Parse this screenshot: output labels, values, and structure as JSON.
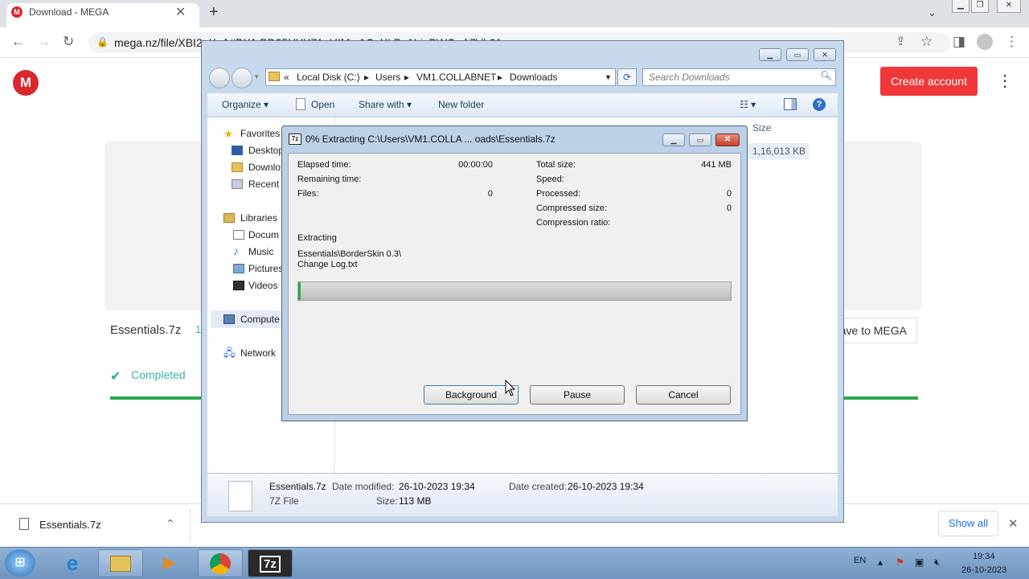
{
  "browser": {
    "tab_title": "Download - MEGA",
    "tab_favicon": "M",
    "tab_close": "✕",
    "new_tab": "+",
    "url": "mega.nz/file/XBI2~K~1#BX1:BD35YYX71_UIM...1C_XLB_1Li_BWQ_A7VL91",
    "window_controls": [
      "▁",
      "❐",
      "✕"
    ],
    "nav_icons": [
      "arrow-left-icon",
      "arrow-right-icon",
      "reload-icon",
      "lock-icon",
      "share-icon",
      "star-icon",
      "sidebar-icon",
      "profile-icon",
      "menu-icon"
    ]
  },
  "mega": {
    "logo": "M",
    "create_account": "Create account",
    "menu_glyph": "⋮",
    "filename": "Essentials.7z",
    "size_fragment": "1",
    "save_to_mega": "ave to MEGA",
    "completed": "Completed",
    "check": "✔",
    "colors": {
      "brand": "#d9272e",
      "button": "#f0373a",
      "progress": "#2ba84e"
    }
  },
  "downloads_shelf": {
    "filename": "Essentials.7z",
    "chevron": "⌃",
    "show_all": "Show all",
    "close": "✕"
  },
  "explorer": {
    "breadcrumbs": [
      "«",
      "Local Disk (C:)",
      "Users",
      "VM1.COLLABNET",
      "Downloads"
    ],
    "search_placeholder": "Search Downloads",
    "commands": {
      "organize": "Organize ▾",
      "open": "Open",
      "share_with": "Share with ▾",
      "new_folder": "New folder"
    },
    "nav": {
      "favorites": "Favorites",
      "desktop": "Desktop",
      "downloads": "Downlo",
      "recent": "Recent",
      "libraries": "Libraries",
      "documents": "Docum",
      "music": "Music",
      "pictures": "Pictures",
      "videos": "Videos",
      "computer": "Compute",
      "network": "Network"
    },
    "column_size": "Size",
    "file_size": "1,16,013 KB",
    "details": {
      "name": "Essentials.7z",
      "type": "7Z File",
      "date_modified_label": "Date modified:",
      "date_modified": "26-10-2023 19:34",
      "size_label": "Size:",
      "size": "113 MB",
      "date_created_label": "Date created:",
      "date_created": "26-10-2023 19:34"
    }
  },
  "sevenzip": {
    "title_icon": "7z",
    "title": "0% Extracting C:\\Users\\VM1.COLLA ... oads\\Essentials.7z",
    "elapsed_label": "Elapsed time:",
    "elapsed": "00:00:00",
    "remaining_label": "Remaining time:",
    "files_label": "Files:",
    "files": "0",
    "total_size_label": "Total size:",
    "total_size": "441 MB",
    "speed_label": "Speed:",
    "processed_label": "Processed:",
    "processed": "0",
    "compressed_label": "Compressed size:",
    "compressed": "0",
    "ratio_label": "Compression ratio:",
    "action": "Extracting",
    "current_path": "Essentials\\BorderSkin 0.3\\",
    "current_file": "Change Log.txt",
    "progress_fraction": 0.005,
    "buttons": {
      "background": "Background",
      "pause": "Pause",
      "cancel": "Cancel"
    }
  },
  "taskbar": {
    "language": "EN",
    "time": "19:34",
    "date": "26-10-2023",
    "seven_zip_label": "7z"
  }
}
